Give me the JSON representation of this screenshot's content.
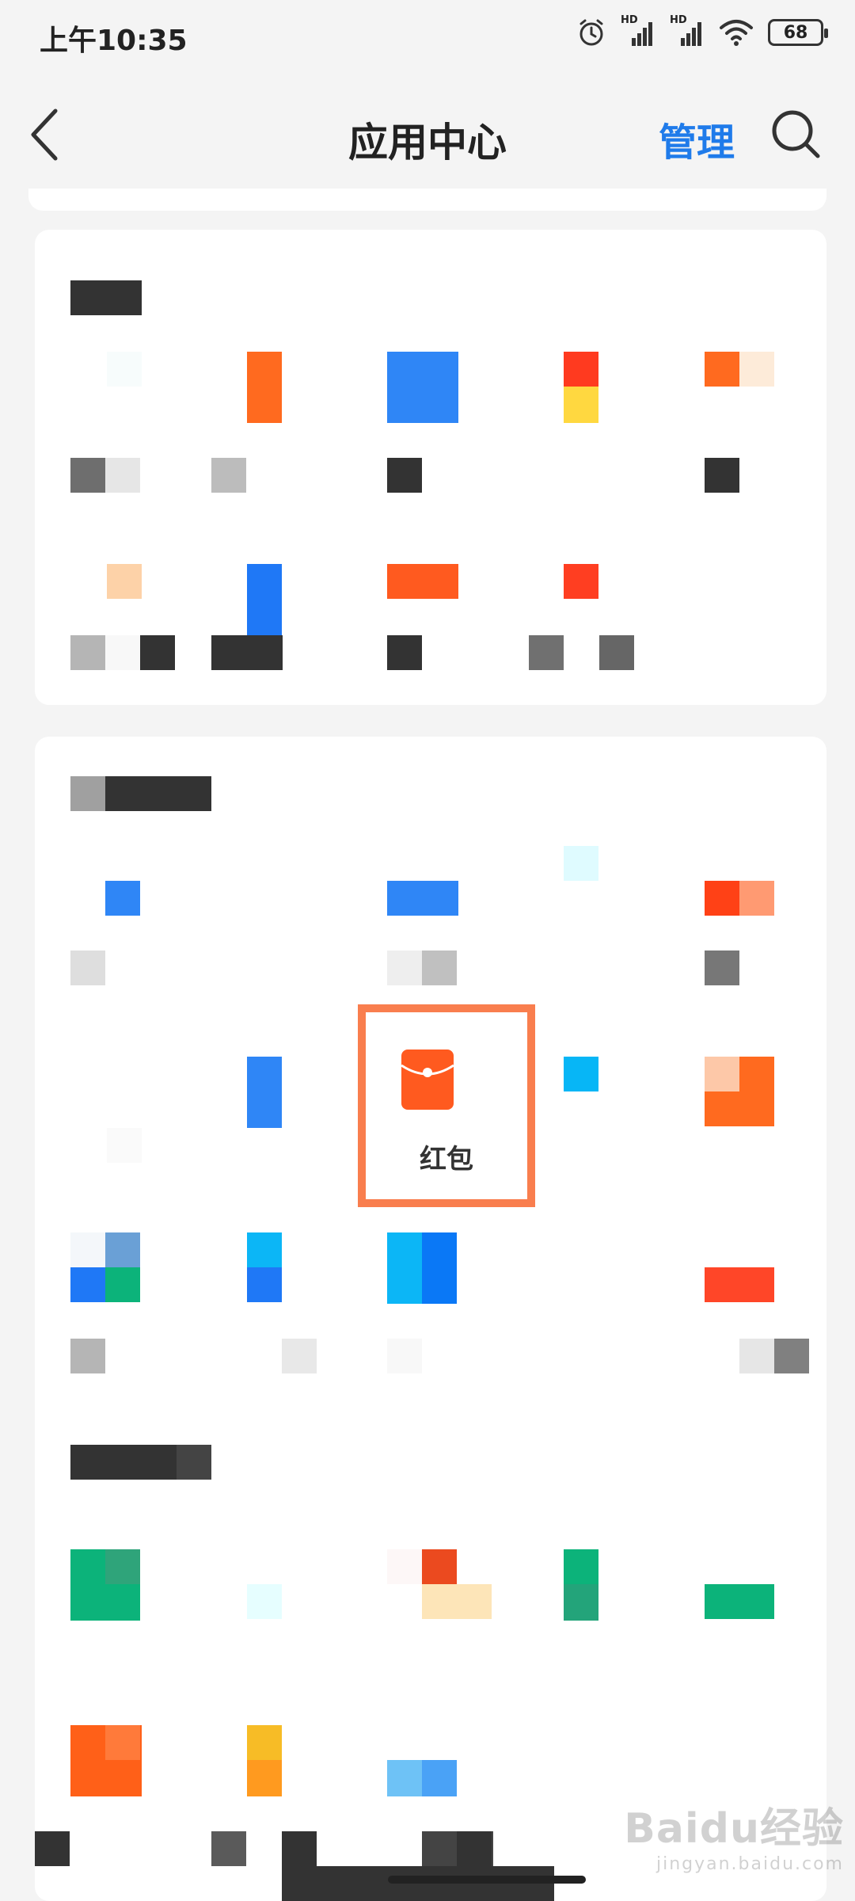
{
  "status_bar": {
    "time": "上午10:35",
    "network_1": "HD",
    "network_2": "HD",
    "battery": "68"
  },
  "header": {
    "title": "应用中心",
    "manage_label": "管理"
  },
  "highlighted_app": {
    "label": "红包",
    "icon": "red-envelope-icon",
    "highlight_color": "#f97e4e",
    "icon_color": "#ff5a1f"
  },
  "watermark": {
    "main": "Baidu经验",
    "sub": "jingyan.baidu.com"
  },
  "colors": {
    "accent": "#1f7bea",
    "background": "#f4f4f4"
  }
}
